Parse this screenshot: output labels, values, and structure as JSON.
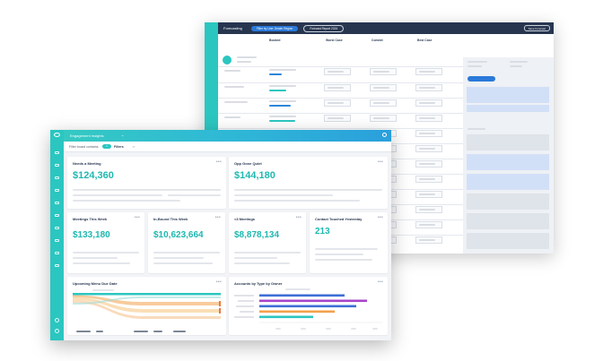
{
  "back_window": {
    "app_title": "Forecasting",
    "filter_pill": "Filter by Line: Dealer Region",
    "dropdown": "Forecast Report 2024",
    "top_right_button": "Save Forecast",
    "columns": [
      "Booked",
      "Worst Case",
      "Commit",
      "Best Case"
    ]
  },
  "front_window": {
    "app_title": "Engagement Insights",
    "filter_bar": {
      "label": "Filter board contains",
      "chip": "1",
      "filters_label": "Filters",
      "clear": "×"
    },
    "cards": {
      "needs_meeting": {
        "title": "Needs a Meeting",
        "value": "$124,360"
      },
      "opp_quiet": {
        "title": "Opp Gone Quiet",
        "value": "$144,180"
      },
      "meetings_week": {
        "title": "Meetings This Week",
        "value": "$133,180"
      },
      "inbound_week": {
        "title": "In-Bound This Week",
        "value": "$10,623,664"
      },
      "three_meetings": {
        "title": "<3 Meetings",
        "value": "$8,878,134"
      },
      "contact_touched": {
        "title": "Contact Touched Yesterday",
        "value": "213"
      },
      "upcoming_menu": {
        "title": "Upcoming Menu Due Date"
      },
      "accounts_by_type": {
        "title": "Accounts by Type by Owner"
      }
    },
    "menu_glyph": "•••"
  },
  "colors": {
    "teal": "#2bc6c0",
    "navy": "#27354f",
    "blue": "#2a79d9",
    "bar_blue": "#3d6fd6",
    "bar_purple": "#a744c9",
    "bar_orange": "#f3a04a",
    "bar_teal": "#2bc6c0"
  },
  "icons": [
    "logo-icon",
    "gear-icon",
    "menu-dots-icon",
    "chevron-down-icon"
  ]
}
